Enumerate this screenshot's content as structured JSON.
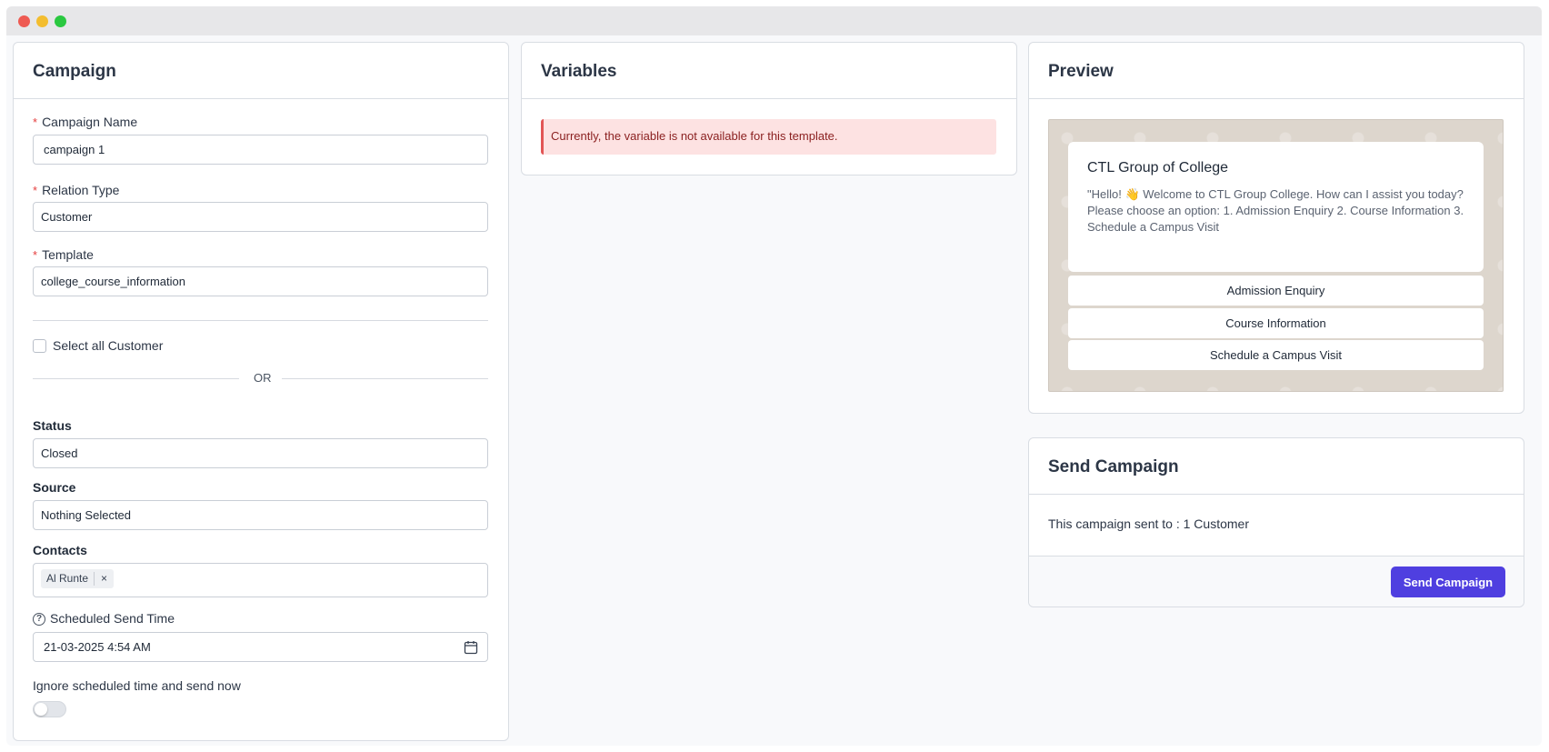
{
  "campaign": {
    "title": "Campaign",
    "campaign_name_label": "Campaign Name",
    "campaign_name_value": "campaign 1",
    "relation_type_label": "Relation Type",
    "relation_type_value": "Customer",
    "template_label": "Template",
    "template_value": "college_course_information",
    "select_all_label": "Select all Customer",
    "select_all_checked": false,
    "or_text": "OR",
    "status_label": "Status",
    "status_value": "Closed",
    "source_label": "Source",
    "source_value": "Nothing Selected",
    "contacts_label": "Contacts",
    "contacts": [
      {
        "name": "Al Runte",
        "remove": "×"
      }
    ],
    "scheduled_label": "Scheduled Send Time",
    "scheduled_value": "21-03-2025 4:54 AM",
    "ignore_label": "Ignore scheduled time and send now",
    "ignore_toggle_on": false
  },
  "variables": {
    "title": "Variables",
    "alert_text": "Currently, the variable is not available for this template."
  },
  "preview": {
    "title": "Preview",
    "message_title": "CTL Group of College",
    "message_body": "\"Hello! 👋 Welcome to CTL Group College. How can I assist you today? Please choose an option: 1. Admission Enquiry 2. Course Information 3. Schedule a Campus Visit",
    "quick_replies": [
      "Admission Enquiry",
      "Course Information",
      "Schedule a Campus Visit"
    ]
  },
  "send": {
    "title": "Send Campaign",
    "summary": "This campaign sent to : 1 Customer",
    "button_label": "Send Campaign"
  },
  "colors": {
    "accent": "#4f3fe0",
    "alert_bg": "#fde2e2",
    "alert_border": "#e25555",
    "required": "#e53e3e"
  }
}
